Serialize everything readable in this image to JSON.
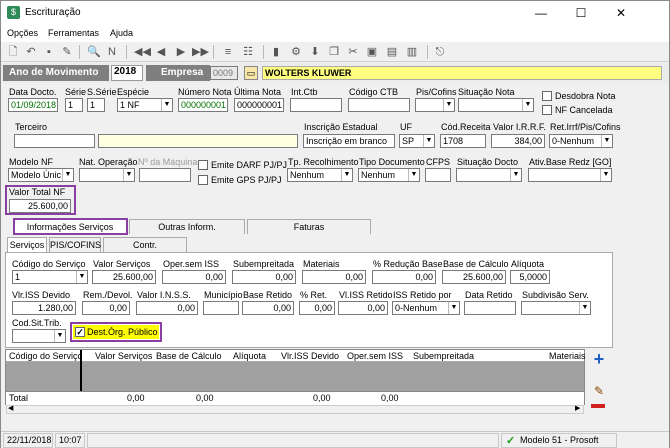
{
  "window": {
    "title": "Escrituração"
  },
  "menu": {
    "items": [
      "Opções",
      "Ferramentas",
      "Ajuda"
    ]
  },
  "ano": {
    "label": "Ano de Movimento",
    "value": "2018",
    "empresa_label": "Empresa",
    "empresa_code": "0009",
    "empresa_name": "WOLTERS KLUWER"
  },
  "row1": {
    "data_docto_label": "Data Docto.",
    "data_docto": "01/09/2018",
    "serie_label": "Série",
    "serie": "1",
    "sserie_label": "S.Série",
    "sserie": "1",
    "especie_label": "Espécie",
    "especie": "1 NF",
    "numero_nota_label": "Número Nota",
    "numero_nota": "000000001",
    "ultima_nota_label": "Última Nota",
    "ultima_nota": "000000001",
    "int_ctb_label": "Int.Ctb",
    "int_ctb": "",
    "codigo_ctb_label": "Código CTB",
    "codigo_ctb": "",
    "pis_cofins_label": "Pis/Cofins",
    "pis_cofins": "",
    "situacao_nota_label": "Situação Nota",
    "situacao_nota": "",
    "desdobra_label": "Desdobra Nota",
    "nf_cancelada_label": "NF Cancelada"
  },
  "row2": {
    "terceiro_label": "Terceiro",
    "terceiro": "",
    "inscricao_label": "Inscrição Estadual",
    "inscricao": "Inscrição em branco",
    "uf_label": "UF",
    "uf": "SP",
    "cod_receita_label": "Cód.Receita",
    "cod_receita": "1708",
    "valor_irrf_label": "Valor I.R.R.F.",
    "valor_irrf": "384,00",
    "ret_irrf_label": "Ret.Irrf/Pis/Cofins",
    "ret_irrf": "0-Nenhum"
  },
  "row3": {
    "modelo_nf_label": "Modelo NF",
    "modelo_nf": "Modelo Únic",
    "nat_operacao_label": "Nat. Operação",
    "nat_operacao": "",
    "no_maquina_label": "Nº da Máquina",
    "no_maquina": "",
    "emite_darf_label": "Emite DARF PJ/PJ",
    "emite_gps_label": "Emite GPS PJ/PJ",
    "tp_recolhimento_label": "Tp. Recolhimento",
    "tp_recolhimento": "Nenhum",
    "tipo_documento_label": "Tipo Documento",
    "tipo_documento": "Nenhum",
    "cfps_label": "CFPS",
    "cfps": "",
    "situacao_docto_label": "Situação Docto",
    "situacao_docto": "",
    "ativ_base_label": "Ativ.Base Redz [GO]",
    "ativ_base": ""
  },
  "valor_total": {
    "label": "Valor Total NF",
    "value": "25.600,00"
  },
  "tabs_top": [
    "Informações Serviços",
    "Outras Inform.",
    "Faturas"
  ],
  "tabs_sub": [
    "Serviços",
    "PIS/COFINS",
    "Contr. Previdenciária"
  ],
  "servicos": {
    "codigo_servico_label": "Código do Serviço",
    "codigo_servico": "1",
    "valor_servicos_label": "Valor Serviços",
    "valor_servicos": "25.600,00",
    "oper_sem_iss_label": "Oper.sem ISS",
    "oper_sem_iss": "0,00",
    "subempreitada_label": "Subempreitada",
    "subempreitada": "0,00",
    "materiais_label": "Materiais",
    "materiais": "0,00",
    "reducao_base_label": "% Redução Base",
    "reducao_base": "0,00",
    "base_calculo_label": "Base de Cálculo",
    "base_calculo": "25.600,00",
    "aliquota_label": "Alíquota",
    "aliquota": "5,0000",
    "vlr_iss_devido_label": "Vlr.ISS Devido",
    "vlr_iss_devido": "1.280,00",
    "rem_devol_label": "Rem./Devol.",
    "rem_devol": "0,00",
    "valor_inss_label": "Valor I.N.S.S.",
    "valor_inss": "0,00",
    "municipio_label": "Município",
    "municipio": "",
    "base_retido_label": "Base Retido",
    "base_retido": "0,00",
    "pct_ret_label": "% Ret.",
    "pct_ret": "0,00",
    "vl_iss_retido_label": "Vl.ISS Retido",
    "vl_iss_retido": "0,00",
    "iss_retido_por_label": "ISS Retido por",
    "iss_retido_por": "0-Nenhum",
    "data_retido_label": "Data Retido",
    "data_retido": "",
    "subdivisao_label": "Subdivisão Serv.",
    "subdivisao": "",
    "cod_sit_trib_label": "Cod.Sit.Trib.",
    "cod_sit_trib": "",
    "dest_org_publico_label": "Dest.Órg. Público"
  },
  "grid": {
    "columns": [
      "Código do Serviço",
      "Valor Serviços",
      "Base de Cálculo",
      "Alíquota",
      "Vlr.ISS Devido",
      "Oper.sem ISS",
      "Subempreitada",
      "Materiais"
    ],
    "total_label": "Total",
    "totals": [
      "0,00",
      "0,00",
      "0,00",
      "0,00"
    ]
  },
  "status": {
    "date": "22/11/2018",
    "time": "10:07",
    "module": "Modelo 51 - Prosoft"
  },
  "colors": {
    "highlight": "#8b3fa0",
    "yellow": "#ffff00",
    "ano_bg": "#7f7f7f",
    "grid_gray": "#a0a0a0",
    "add_blue": "#1f5fbf",
    "remove_red": "#d02020"
  }
}
